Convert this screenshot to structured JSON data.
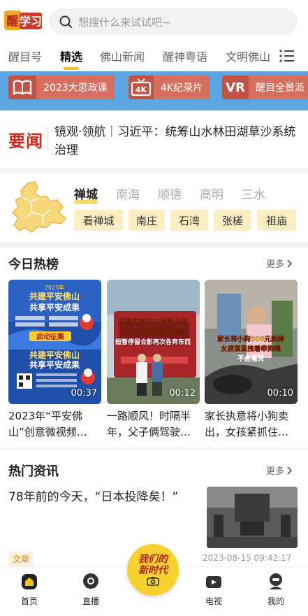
{
  "header": {
    "logo_text": "学习",
    "logo_char": "醒",
    "search_placeholder": "想搜什么来试试吧~"
  },
  "tabs": [
    "醒目号",
    "精选",
    "佛山新闻",
    "醒神粤语",
    "文明佛山"
  ],
  "active_tab": "精选",
  "banner": {
    "items": [
      {
        "icon": "book-icon",
        "label": "2023大思政课"
      },
      {
        "icon": "tv-4k-icon",
        "icon_text": "4K",
        "label": "4K纪录片"
      },
      {
        "icon": "vr-icon",
        "icon_text": "VR",
        "label": "醒目全景派"
      }
    ]
  },
  "headline": {
    "badge": "要闻",
    "text": "镜观·领航｜习近平：统筹山水林田湖草沙系统治理"
  },
  "district": {
    "tabs": [
      "禅城",
      "南海",
      "顺德",
      "高明",
      "三水"
    ],
    "active": "禅城",
    "towns": [
      "看禅城",
      "南庄",
      "石湾",
      "张槎",
      "祖庙"
    ]
  },
  "hot_list": {
    "title": "今日热榜",
    "more_label": "更多",
    "videos": [
      {
        "duration": "00:37",
        "caption": "2023年“平安佛山”创意微视频…",
        "poster_top": "共建平安佛山",
        "poster_mid": "共享平安成果",
        "poster_btn": "启动征集",
        "poster_year": "2023年"
      },
      {
        "duration": "00:12",
        "caption": "一路顺风！时隔半年，父子俩驾驶…",
        "overlay1": "开货车的父子半年未见",
        "overlay2": "他们服务区难得相遇",
        "overlay3": "短暂停留合影再次各奔东西"
      },
      {
        "duration": "00:10",
        "caption": "家长执意将小狗卖出，女孩紧抓住…",
        "overlay1": "家长将小狗300元卖掉",
        "overlay2": "女孩紧紧拽着牵狗绳",
        "overlay3": "不舍痛哭"
      }
    ]
  },
  "hot_news": {
    "title": "热门资讯",
    "more_label": "更多",
    "article": {
      "title": "78年前的今天，“日本投降矣！”",
      "tag": "文章",
      "time": "2023-08-15 09:42:17"
    }
  },
  "bottom_nav": {
    "items": [
      {
        "label": "首页",
        "icon": "home-icon",
        "active": true
      },
      {
        "label": "直播",
        "icon": "live-icon"
      },
      {
        "label": "电视",
        "icon": "tv-icon"
      },
      {
        "label": "我的",
        "icon": "profile-icon"
      }
    ],
    "center_line1": "我们的",
    "center_line2": "新时代"
  },
  "colors": {
    "accent_yellow": "#f5c518",
    "headline_red": "#d1261a",
    "banner_blue": "#5ba6e0"
  }
}
